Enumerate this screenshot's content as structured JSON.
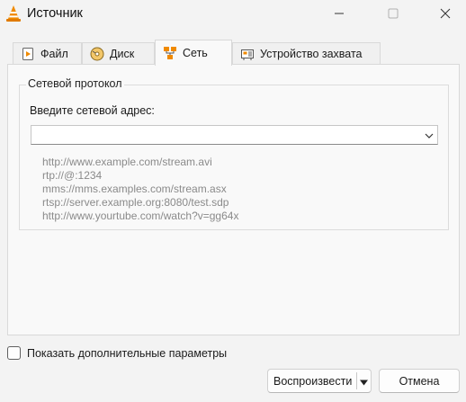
{
  "window": {
    "title": "Источник",
    "icon": "vlc-cone-icon"
  },
  "tabs": [
    {
      "label": "Файл",
      "icon": "file-play-icon",
      "active": false
    },
    {
      "label": "Диск",
      "icon": "disc-icon",
      "active": false
    },
    {
      "label": "Сеть",
      "icon": "network-icon",
      "active": true
    },
    {
      "label": "Устройство захвата",
      "icon": "capture-card-icon",
      "active": false
    }
  ],
  "network": {
    "group_title": "Сетевой протокол",
    "address_label": "Введите сетевой адрес:",
    "address_value": "",
    "examples": [
      "http://www.example.com/stream.avi",
      "rtp://@:1234",
      "mms://mms.examples.com/stream.asx",
      "rtsp://server.example.org:8080/test.sdp",
      "http://www.yourtube.com/watch?v=gg64x"
    ]
  },
  "options": {
    "show_more_label": "Показать дополнительные параметры",
    "checked": false
  },
  "buttons": {
    "play_label": "Воспроизвести",
    "cancel_label": "Отмена"
  },
  "colors": {
    "accent_orange": "#f08a00",
    "window_bg": "#f3f3f3"
  }
}
